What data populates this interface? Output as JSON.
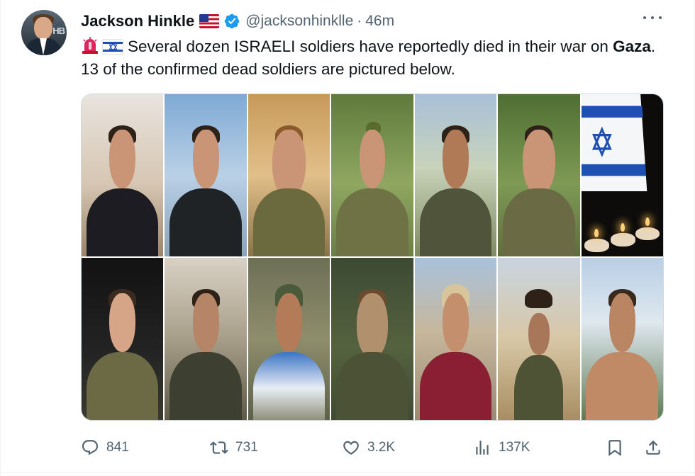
{
  "author": {
    "display_name": "Jackson Hinkle",
    "handle": "@jacksonhinklle",
    "separator": "·",
    "time": "46m",
    "verified": true,
    "avatar_text": "HB"
  },
  "tweet": {
    "text_part1": "Several dozen ISRAELI soldiers have reportedly died in their war on",
    "text_bold": "Gaza",
    "text_part2": ". 13 of the confirmed dead soldiers are pictured below.",
    "emojis": [
      "siren-emoji",
      "israel-flag-emoji"
    ]
  },
  "media": {
    "photo_count": 14
  },
  "actions": {
    "replies": "841",
    "reposts": "731",
    "likes": "3.2K",
    "views": "137K"
  },
  "colors": {
    "text_primary": "#0f1419",
    "text_secondary": "#536471",
    "verified_blue": "#1d9bf0",
    "border": "#cfd9de"
  }
}
